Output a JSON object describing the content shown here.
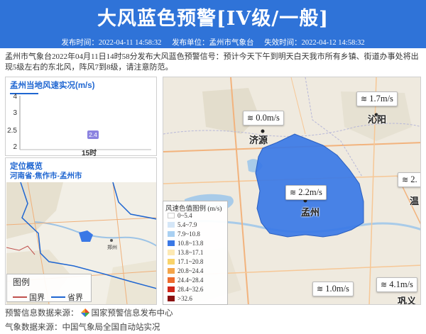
{
  "header": {
    "title": "大风蓝色预警[IV级/一般]",
    "publish_time": "发布时间：2022-04-11 14:58:32",
    "publisher": "发布单位：孟州市气象台",
    "expire_time": "失效时间：2022-04-12 14:58:32"
  },
  "content": "孟州市气象台2022年04月11日14时58分发布大风蓝色预警信号：预计今天下午到明天白天我市所有乡镇、街道办事处将出现5级左右的东北风，阵风7到8级，请注意防范。",
  "speed_panel": {
    "title": "孟州当地风速实况(m/s)",
    "y_ticks": [
      "4",
      "3",
      "2.5",
      "2"
    ],
    "x_label": "15时",
    "point_label": "2.4"
  },
  "chart_data": {
    "type": "line",
    "title": "孟州当地风速实况(m/s)",
    "categories": [
      "15时"
    ],
    "values": [
      2.4
    ],
    "ylim": [
      2,
      4
    ]
  },
  "locate_panel": {
    "title": "定位概览",
    "region": "河南省-焦作市-孟州市",
    "mini_label": "郑州"
  },
  "map_legend": {
    "title": "图例",
    "items": [
      {
        "label": "国界",
        "color": "#c0504d"
      },
      {
        "label": "省界",
        "color": "#1f66d1"
      }
    ]
  },
  "wind_tags": [
    {
      "text": "0.0m/s"
    },
    {
      "text": "1.7m/s"
    },
    {
      "text": "2.2m/s"
    },
    {
      "text": "2."
    },
    {
      "text": "1.0m/s"
    },
    {
      "text": "4.1m/s"
    }
  ],
  "cities": {
    "jiyuan": "济源",
    "qinyang": "沁阳",
    "mengzhou": "孟州",
    "wen": "温",
    "gongyi": "巩义"
  },
  "wind_legend": {
    "title": "风速色值图例 (m/s)",
    "rows": [
      {
        "label": "0~5.4",
        "color": "#ffffff"
      },
      {
        "label": "5.4~7.9",
        "color": "#d4e6f7"
      },
      {
        "label": "7.9~10.8",
        "color": "#a9d0f2"
      },
      {
        "label": "10.8~13.8",
        "color": "#3a78e6"
      },
      {
        "label": "13.8~17.1",
        "color": "#fde9b3"
      },
      {
        "label": "17.1~20.8",
        "color": "#f9d36a"
      },
      {
        "label": "20.8~24.4",
        "color": "#f4a54b"
      },
      {
        "label": "24.4~28.4",
        "color": "#ee6b2d"
      },
      {
        "label": "28.4~32.6",
        "color": "#d0261a"
      },
      {
        "label": ">32.6",
        "color": "#8a1010"
      }
    ]
  },
  "footer": {
    "warning_source_label": "预警信息数据来源：",
    "warning_source": "国家预警信息发布中心",
    "weather_source": "气象数据来源：中国气象局全国自动站实况"
  }
}
